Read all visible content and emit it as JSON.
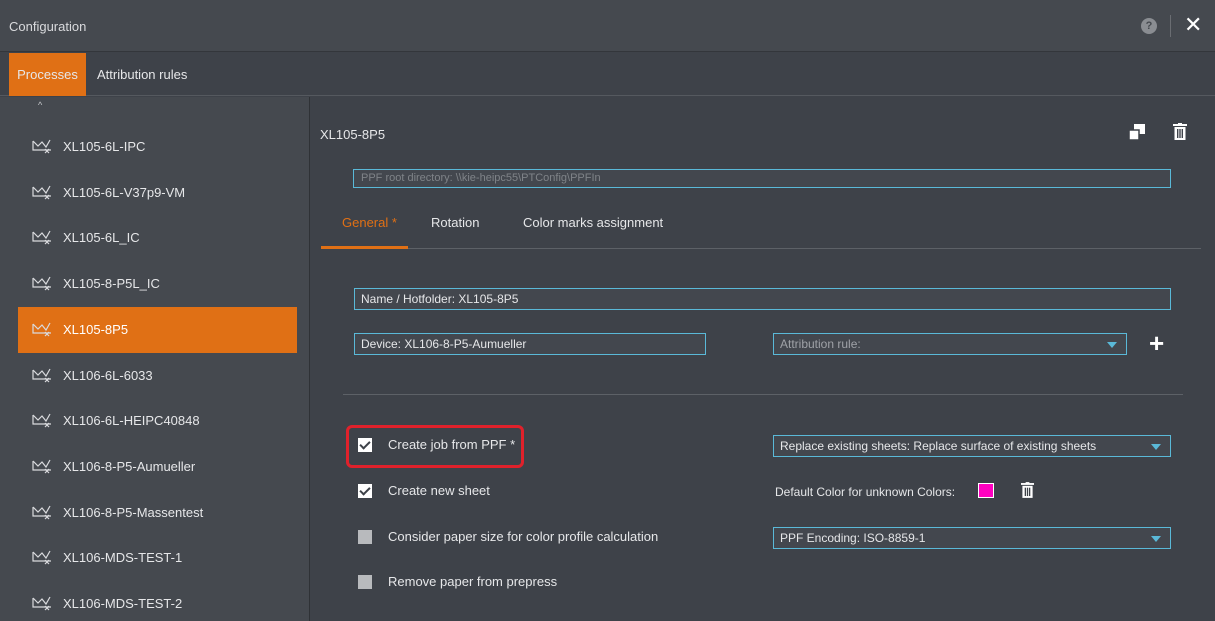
{
  "window": {
    "title": "Configuration",
    "help_glyph": "?",
    "close_glyph": "✕"
  },
  "tabs": [
    {
      "label": "Processes",
      "active": true
    },
    {
      "label": "Attribution rules",
      "active": false
    }
  ],
  "sidebar": {
    "scroll_glyph": "^",
    "items": [
      {
        "label": "XL105-6L-IPC",
        "icon": "process-icon"
      },
      {
        "label": "XL105-6L-V37p9-VM",
        "icon": "process-icon"
      },
      {
        "label": "XL105-6L_IC",
        "icon": "process-icon"
      },
      {
        "label": "XL105-8-P5L_IC",
        "icon": "process-icon"
      },
      {
        "label": "XL105-8P5",
        "icon": "process-icon",
        "active": true
      },
      {
        "label": "XL106-6L-6033",
        "icon": "process-icon"
      },
      {
        "label": "XL106-6L-HEIPC40848",
        "icon": "process-icon"
      },
      {
        "label": "XL106-8-P5-Aumueller",
        "icon": "process-icon"
      },
      {
        "label": "XL106-8-P5-Massentest",
        "icon": "process-icon"
      },
      {
        "label": "XL106-MDS-TEST-1",
        "icon": "process-icon"
      },
      {
        "label": "XL106-MDS-TEST-2",
        "icon": "process-icon"
      }
    ]
  },
  "main": {
    "process_title": "XL105-8P5",
    "root_directory": "PPF root directory: \\\\kie-heipc55\\PTConfig\\PPFIn",
    "sub_tabs": [
      {
        "label": "General *",
        "active": true
      },
      {
        "label": "Rotation"
      },
      {
        "label": "Color marks assignment"
      }
    ],
    "name_hotfolder": "Name / Hotfolder: XL105-8P5",
    "device": "Device: XL106-8-P5-Aumueller",
    "attribution_rule": "Attribution rule:",
    "plus_glyph": "+",
    "options": {
      "create_job": {
        "label": "Create job from PPF  *",
        "checked": true
      },
      "create_sheet": {
        "label": "Create new sheet",
        "checked": true
      },
      "paper_size": {
        "label": "Consider paper size for color profile calculation",
        "checked": false
      },
      "remove_paper": {
        "label": "Remove paper from prepress",
        "checked": false
      }
    },
    "replace_sheets": "Replace existing sheets: Replace surface of existing sheets",
    "default_color_label": "Default Color for unknown Colors:",
    "default_color": "#ff00c0",
    "ppf_encoding": "PPF Encoding: ISO-8859-1"
  },
  "colors": {
    "accent": "#e07015",
    "field_border": "#5ab9d8",
    "highlight": "#e0212b"
  }
}
